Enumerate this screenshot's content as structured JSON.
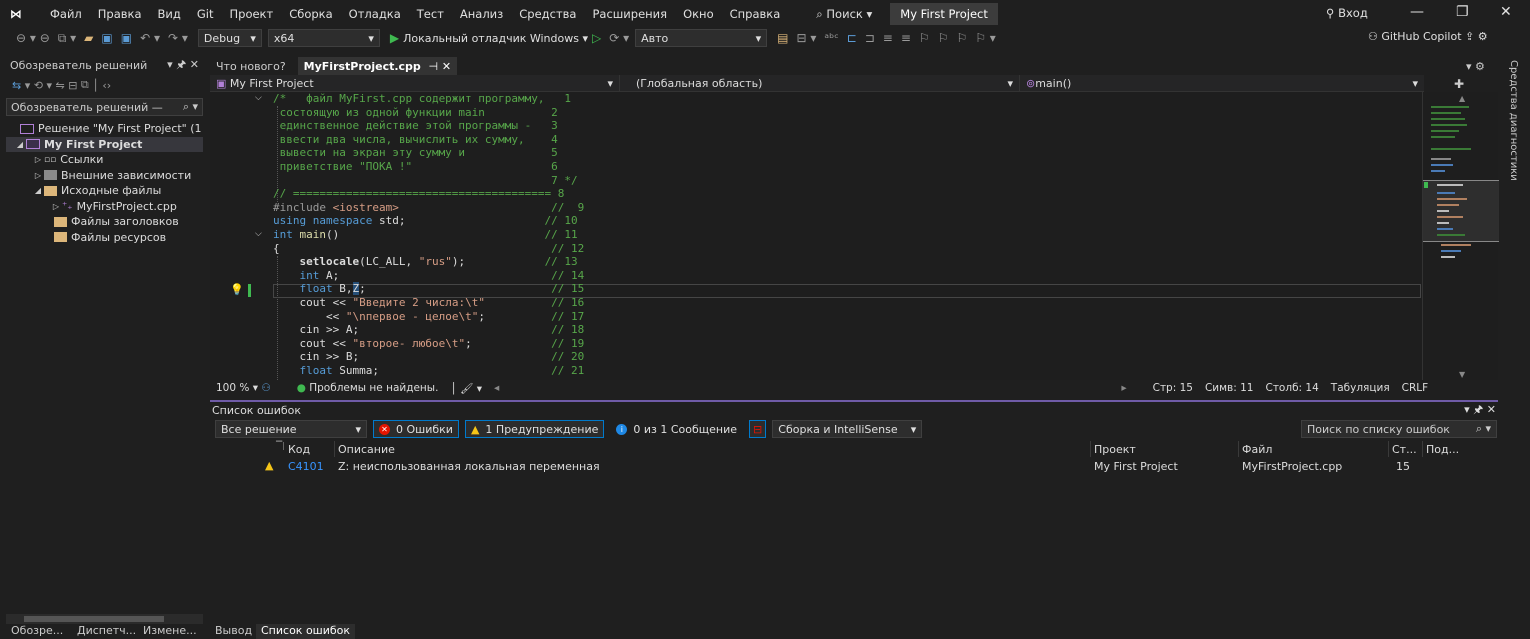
{
  "menu": [
    "Файл",
    "Правка",
    "Вид",
    "Git",
    "Проект",
    "Сборка",
    "Отладка",
    "Тест",
    "Анализ",
    "Средства",
    "Расширения",
    "Окно",
    "Справка"
  ],
  "search_label": "Поиск",
  "project_title": "My First Project",
  "login_label": "Вход",
  "toolbar": {
    "config": "Debug",
    "platform": "x64",
    "debugger": "Локальный отладчик Windows",
    "auto": "Авто",
    "copilot": "GitHub Copilot"
  },
  "solution_explorer": {
    "title": "Обозреватель решений",
    "search_placeholder": "Обозреватель решений —",
    "items": [
      {
        "label": "Решение \"My First Project\" (1"
      },
      {
        "label": "My First Project"
      },
      {
        "label": "Ссылки"
      },
      {
        "label": "Внешние зависимости"
      },
      {
        "label": "Исходные файлы"
      },
      {
        "label": "MyFirstProject.cpp"
      },
      {
        "label": "Файлы заголовков"
      },
      {
        "label": "Файлы ресурсов"
      }
    ]
  },
  "bottom_tabs_left": [
    "Обозре...",
    "Диспетч...",
    "Измене..."
  ],
  "bottom_tabs_right": [
    "Вывод",
    "Список ошибок"
  ],
  "editor": {
    "tabs": [
      "Что нового?",
      "MyFirstProject.cpp"
    ],
    "nav_project": "My First Project",
    "nav_scope": "(Глобальная область)",
    "nav_member": "main()"
  },
  "side_panel": "Средства диагностики",
  "status": {
    "zoom": "100 %",
    "problems": "Проблемы не найдены.",
    "line": "Стр: 15",
    "char": "Симв: 11",
    "col": "Столб: 14",
    "tabs": "Табуляция",
    "eol": "CRLF"
  },
  "error_list": {
    "title": "Список ошибок",
    "scope": "Все решение",
    "errors": "0 Ошибки",
    "warnings": "1 Предупреждение",
    "messages": "0 из 1 Сообщение",
    "build": "Сборка и IntelliSense",
    "search": "Поиск по списку ошибок",
    "columns": [
      "Код",
      "Описание",
      "Проект",
      "Файл",
      "Ст...",
      "Под..."
    ],
    "rows": [
      {
        "code": "C4101",
        "desc": "Z: неиспользованная локальная переменная",
        "project": "My First Project",
        "file": "MyFirstProject.cpp",
        "line": "15"
      }
    ]
  },
  "colors": {
    "accent": "#007acc",
    "warning": "#f5c518",
    "error": "#e51400",
    "ok": "#3fb950",
    "purple": "#6f5ba7"
  }
}
